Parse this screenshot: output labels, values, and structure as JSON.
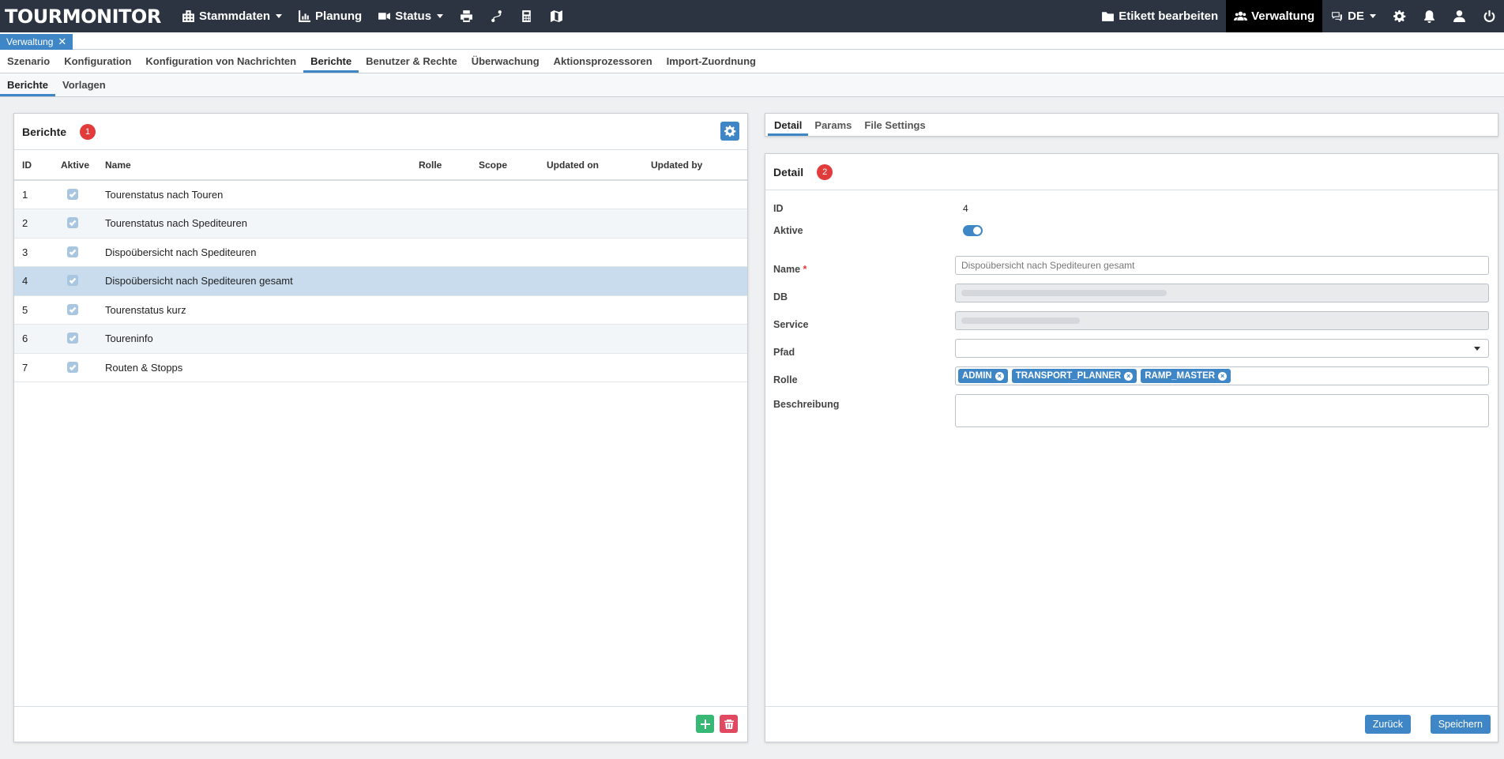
{
  "app": {
    "logo": "TOURMONITOR"
  },
  "navbar": {
    "left": [
      {
        "label": "Stammdaten",
        "icon": "building-icon",
        "dropdown": true
      },
      {
        "label": "Planung",
        "icon": "chart-icon",
        "dropdown": false
      },
      {
        "label": "Status",
        "icon": "video-icon",
        "dropdown": true
      }
    ],
    "icon_buttons": [
      "printer-icon",
      "route-icon",
      "calculator-icon",
      "map-icon"
    ],
    "right": {
      "edit_label": "Etikett bearbeiten",
      "admin_label": "Verwaltung",
      "language": "DE"
    }
  },
  "open_tabs": [
    {
      "label": "Verwaltung",
      "close": "✕"
    }
  ],
  "menu_primary": [
    "Szenario",
    "Konfiguration",
    "Konfiguration von Nachrichten",
    "Berichte",
    "Benutzer & Rechte",
    "Überwachung",
    "Aktionsprozessoren",
    "Import-Zuordnung"
  ],
  "menu_secondary": [
    "Berichte",
    "Vorlagen"
  ],
  "reports_panel": {
    "title": "Berichte",
    "badge": "1",
    "columns": [
      "ID",
      "Aktive",
      "Name",
      "Rolle",
      "Scope",
      "Updated on",
      "Updated by"
    ],
    "rows": [
      {
        "id": "1",
        "active": true,
        "name": "Tourenstatus nach Touren",
        "rolle": "",
        "scope": "",
        "updated_on": "",
        "updated_by": ""
      },
      {
        "id": "2",
        "active": true,
        "name": "Tourenstatus nach Spediteuren",
        "rolle": "",
        "scope": "",
        "updated_on": "",
        "updated_by": ""
      },
      {
        "id": "3",
        "active": true,
        "name": "Dispoübersicht nach Spediteuren",
        "rolle": "",
        "scope": "",
        "updated_on": "",
        "updated_by": ""
      },
      {
        "id": "4",
        "active": true,
        "name": "Dispoübersicht nach Spediteuren gesamt",
        "rolle": "",
        "scope": "",
        "updated_on": "",
        "updated_by": ""
      },
      {
        "id": "5",
        "active": true,
        "name": "Tourenstatus kurz",
        "rolle": "",
        "scope": "",
        "updated_on": "",
        "updated_by": ""
      },
      {
        "id": "6",
        "active": true,
        "name": "Toureninfo",
        "rolle": "",
        "scope": "",
        "updated_on": "",
        "updated_by": ""
      },
      {
        "id": "7",
        "active": true,
        "name": "Routen & Stopps",
        "rolle": "",
        "scope": "",
        "updated_on": "",
        "updated_by": ""
      }
    ],
    "selected_id": "4"
  },
  "detail_tabs": [
    "Detail",
    "Params",
    "File Settings"
  ],
  "detail": {
    "title": "Detail",
    "badge": "2",
    "labels": {
      "id": "ID",
      "active": "Aktive",
      "name": "Name",
      "required_mark": "*",
      "db": "DB",
      "service": "Service",
      "path": "Pfad",
      "role": "Rolle",
      "description": "Beschreibung"
    },
    "id_value": "4",
    "active_value": true,
    "name_value": "Dispoübersicht nach Spediteuren gesamt",
    "path_value": "",
    "roles": [
      "ADMIN",
      "TRANSPORT_PLANNER",
      "RAMP_MASTER"
    ],
    "chip_remove": "×",
    "description_value": "",
    "back_label": "Zurück",
    "save_label": "Speichern"
  },
  "colors": {
    "navbar": "#2b3440",
    "accent": "#3f86c7",
    "badge": "#e23b3b",
    "add": "#37b874",
    "delete": "#e0495f",
    "selected_row": "#c9dcee"
  }
}
